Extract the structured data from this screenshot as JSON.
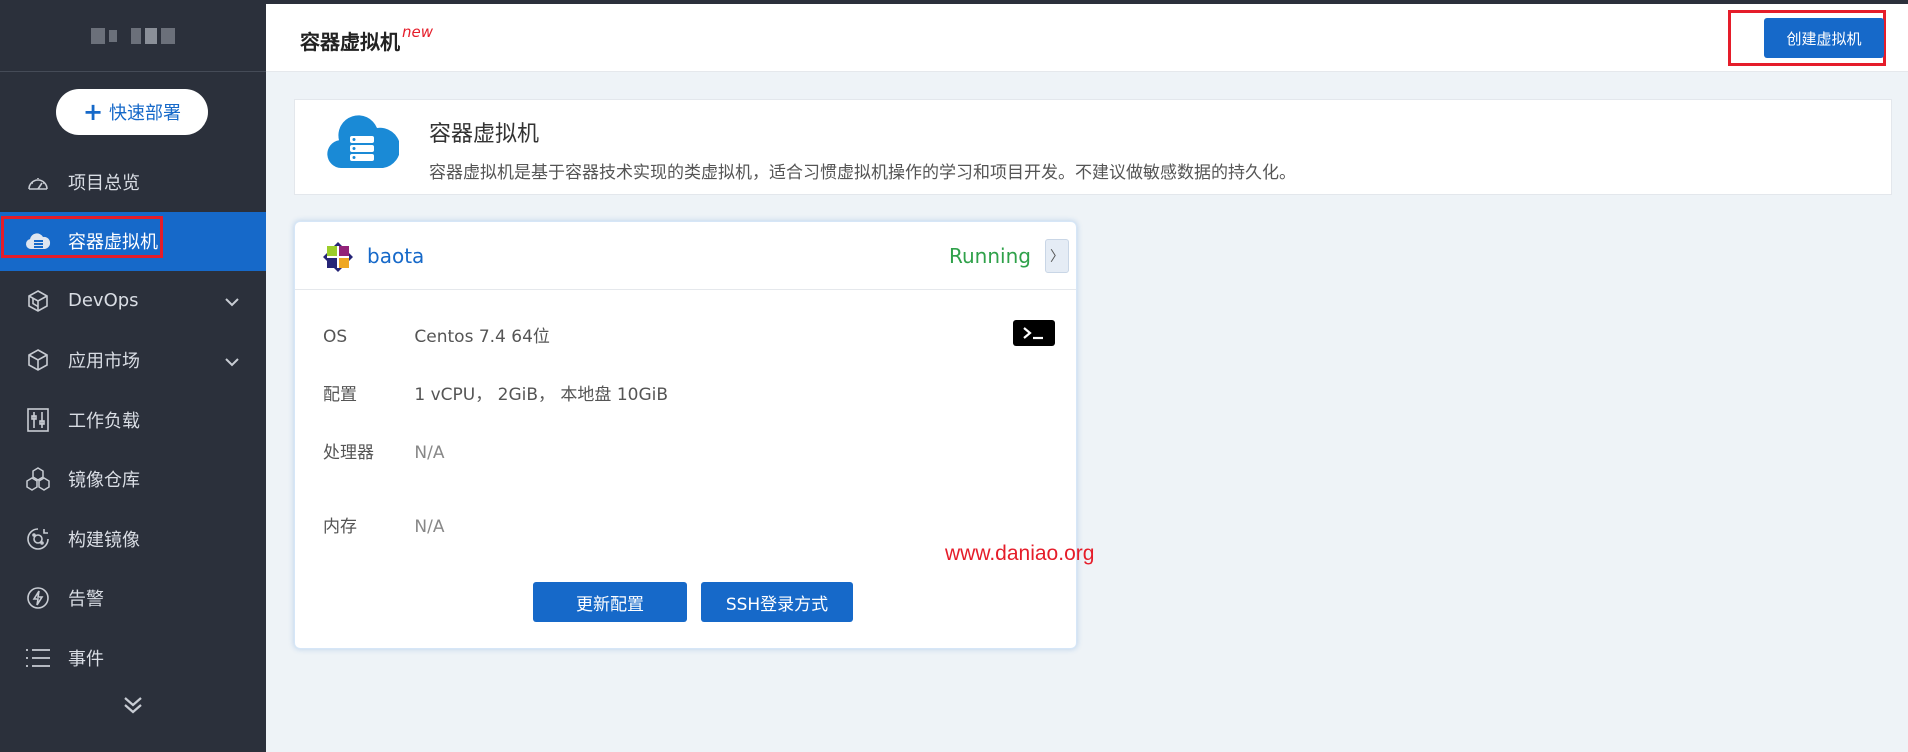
{
  "header": {
    "title": "容器虚拟机",
    "title_badge": "new",
    "create_button": "创建虚拟机"
  },
  "sidebar": {
    "quick_deploy": "快速部署",
    "items": [
      {
        "label": "项目总览",
        "icon": "gauge-icon"
      },
      {
        "label": "容器虚拟机",
        "icon": "cloud-server-icon",
        "active": true
      },
      {
        "label": "DevOps",
        "icon": "cube-icon",
        "expandable": true
      },
      {
        "label": "应用市场",
        "icon": "box-icon",
        "expandable": true
      },
      {
        "label": "工作负载",
        "icon": "sliders-icon"
      },
      {
        "label": "镜像仓库",
        "icon": "hexagons-icon"
      },
      {
        "label": "构建镜像",
        "icon": "build-icon"
      },
      {
        "label": "告警",
        "icon": "lightning-icon"
      },
      {
        "label": "事件",
        "icon": "list-icon"
      }
    ]
  },
  "intro": {
    "title": "容器虚拟机",
    "description": "容器虚拟机是基于容器技术实现的类虚拟机，适合习惯虚拟机操作的学习和项目开发。不建议做敏感数据的持久化。"
  },
  "vm": {
    "name": "baota",
    "status": "Running",
    "os_label": "OS",
    "os_value": "Centos 7.4 64位",
    "config_label": "配置",
    "config_value": "1 vCPU， 2GiB， 本地盘 10GiB",
    "cpu_label": "处理器",
    "cpu_value": "N/A",
    "mem_label": "内存",
    "mem_value": "N/A",
    "update_button": "更新配置",
    "ssh_button": "SSH登录方式"
  },
  "watermark": "www.daniao.org",
  "colors": {
    "primary": "#1669c9",
    "sidebar": "#2b303b",
    "running": "#2fa14a",
    "highlight": "#e51d2a"
  }
}
